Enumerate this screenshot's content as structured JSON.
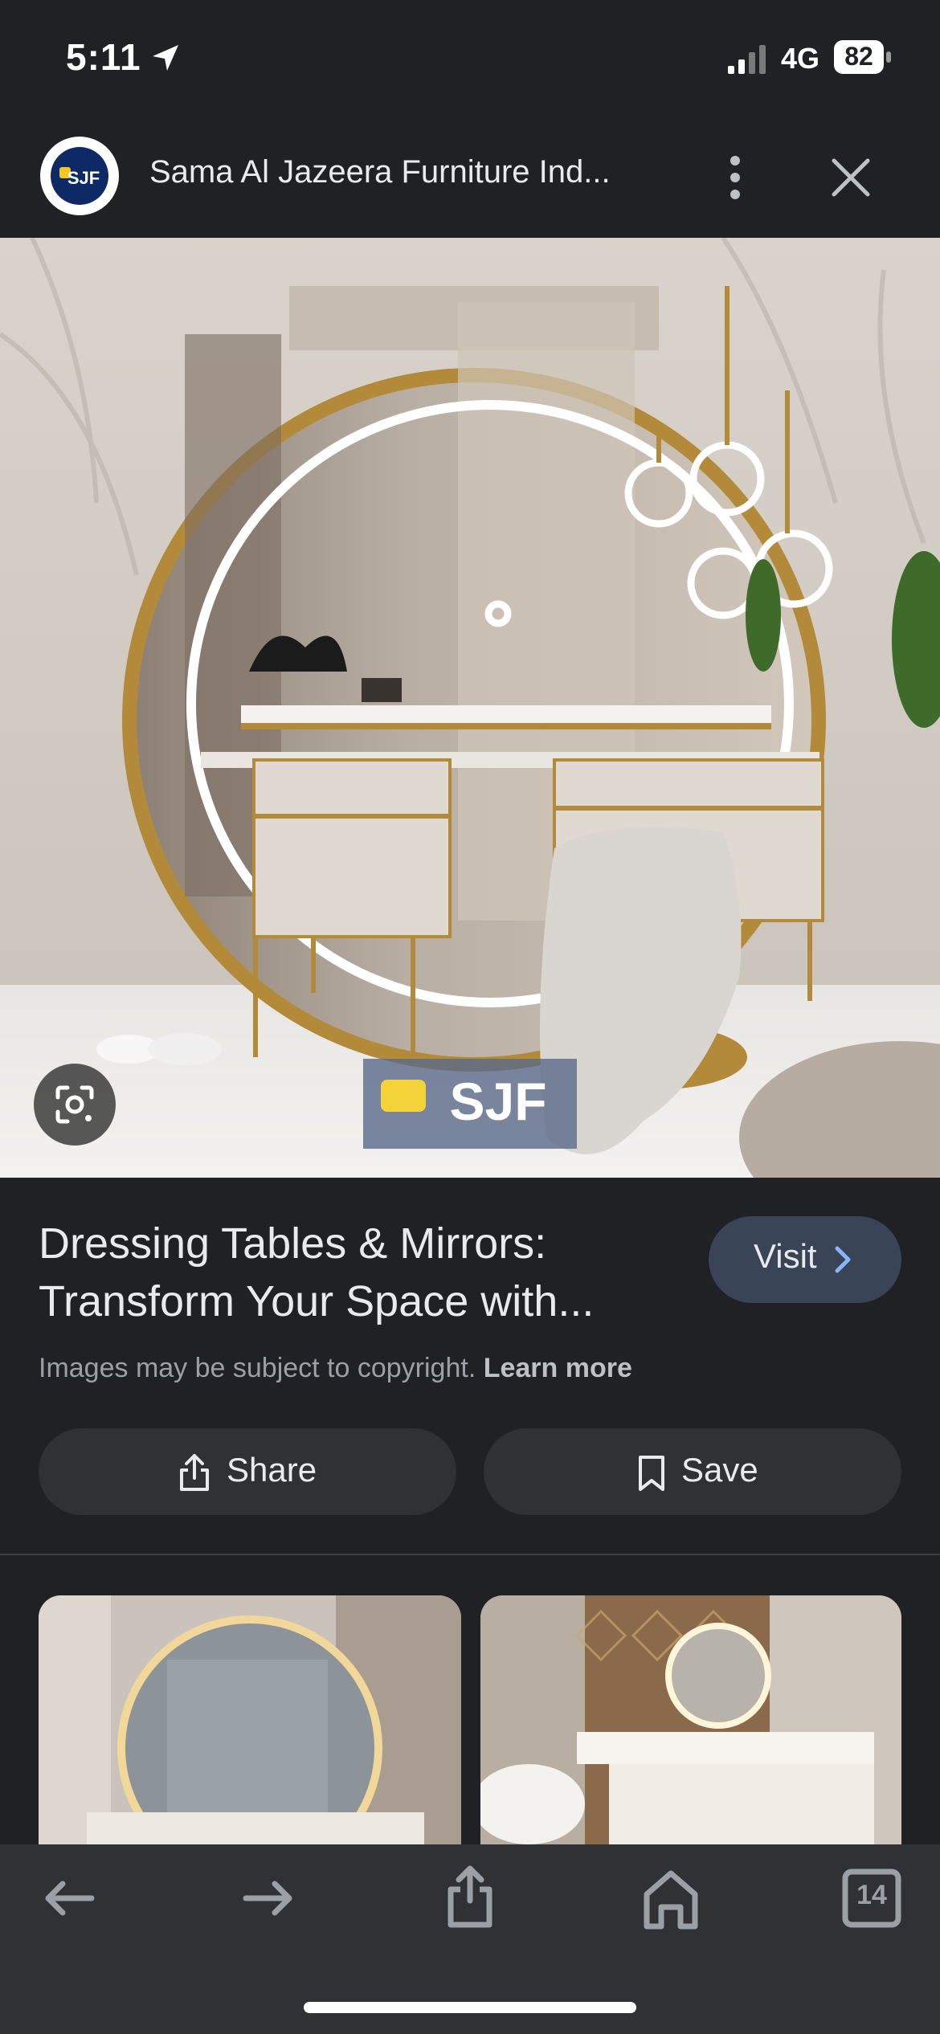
{
  "status_bar": {
    "time": "5:11",
    "network": "4G",
    "battery": "82"
  },
  "header": {
    "site_title": "Sama Al Jazeera Furniture Ind...",
    "logo_text": "SJF"
  },
  "image": {
    "watermark": "SJF"
  },
  "result": {
    "title": "Dressing Tables & Mirrors: Transform Your Space with...",
    "visit_label": "Visit",
    "copyright_text": "Images may be subject to copyright.",
    "learn_more": "Learn more"
  },
  "actions": {
    "share_label": "Share",
    "save_label": "Save"
  },
  "toolbar": {
    "tabs_count": "14"
  },
  "colors": {
    "background": "#202124",
    "visit_button": "#394457",
    "pill_button": "#303134",
    "toolbar": "#303134"
  }
}
